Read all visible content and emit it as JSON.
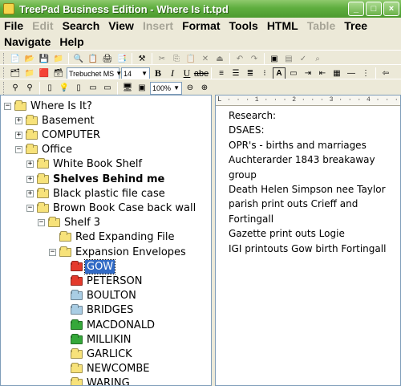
{
  "window": {
    "title": "TreePad Business Edition - Where Is it.tpd",
    "minimize": "_",
    "maximize": "□",
    "close": "×"
  },
  "menu": {
    "row1": [
      {
        "label": "File",
        "enabled": true
      },
      {
        "label": "Edit",
        "enabled": false
      },
      {
        "label": "Search",
        "enabled": true
      },
      {
        "label": "View",
        "enabled": true
      },
      {
        "label": "Insert",
        "enabled": false
      },
      {
        "label": "Format",
        "enabled": true
      },
      {
        "label": "Tools",
        "enabled": true
      },
      {
        "label": "HTML",
        "enabled": true
      },
      {
        "label": "Table",
        "enabled": false
      },
      {
        "label": "Tree",
        "enabled": true
      }
    ],
    "row2": [
      {
        "label": "Navigate",
        "enabled": true
      },
      {
        "label": "Help",
        "enabled": true
      }
    ]
  },
  "toolbar": {
    "font_name": "Trebuchet MS",
    "font_size": "14",
    "zoom": "100%",
    "bold": "B",
    "italic": "I",
    "underline": "U",
    "strike": "abe",
    "font_color": "A"
  },
  "tree": {
    "nodes": [
      {
        "label": "Where Is It?",
        "color": "yellow",
        "expander": "−",
        "bold": false,
        "selected": false
      },
      {
        "label": "Basement",
        "color": "yellow",
        "expander": "+",
        "bold": false,
        "selected": false
      },
      {
        "label": "COMPUTER",
        "color": "yellow",
        "expander": "+",
        "bold": false,
        "selected": false
      },
      {
        "label": "Office",
        "color": "yellow",
        "expander": "−",
        "bold": false,
        "selected": false
      },
      {
        "label": "White Book Shelf",
        "color": "yellow",
        "expander": "+",
        "bold": false,
        "selected": false
      },
      {
        "label": "Shelves Behind me",
        "color": "yellow",
        "expander": "+",
        "bold": true,
        "selected": false
      },
      {
        "label": "Black plastic file case",
        "color": "yellow",
        "expander": "+",
        "bold": false,
        "selected": false
      },
      {
        "label": "Brown Book Case back wall",
        "color": "yellow",
        "expander": "−",
        "bold": false,
        "selected": false
      },
      {
        "label": "Shelf 3",
        "color": "yellow",
        "expander": "−",
        "bold": false,
        "selected": false
      },
      {
        "label": "Red Expanding File",
        "color": "yellow",
        "expander": "",
        "bold": false,
        "selected": false
      },
      {
        "label": "Expansion Envelopes",
        "color": "yellow",
        "expander": "−",
        "bold": false,
        "selected": false
      },
      {
        "label": "GOW",
        "color": "red",
        "expander": "",
        "bold": false,
        "selected": true
      },
      {
        "label": "PETERSON",
        "color": "red",
        "expander": "",
        "bold": false,
        "selected": false
      },
      {
        "label": "BOULTON",
        "color": "blue",
        "expander": "",
        "bold": false,
        "selected": false
      },
      {
        "label": "BRIDGES",
        "color": "blue",
        "expander": "",
        "bold": false,
        "selected": false
      },
      {
        "label": "MACDONALD",
        "color": "green",
        "expander": "",
        "bold": false,
        "selected": false
      },
      {
        "label": "MILLIKIN",
        "color": "green",
        "expander": "",
        "bold": false,
        "selected": false
      },
      {
        "label": "GARLICK",
        "color": "yellow",
        "expander": "",
        "bold": false,
        "selected": false
      },
      {
        "label": "NEWCOMBE",
        "color": "yellow",
        "expander": "",
        "bold": false,
        "selected": false
      },
      {
        "label": "WARING",
        "color": "yellow",
        "expander": "",
        "bold": false,
        "selected": false
      }
    ]
  },
  "editor": {
    "lines": [
      "Research:",
      "DSAES:",
      "OPR's - births and marriages",
      "Auchterarder 1843 breakaway group",
      "Death Helen Simpson nee Taylor",
      "parish print outs Crieff and Fortingall",
      "Gazette print outs Logie",
      "IGI printouts Gow birth Fortingall"
    ],
    "ruler_marker": "L"
  }
}
